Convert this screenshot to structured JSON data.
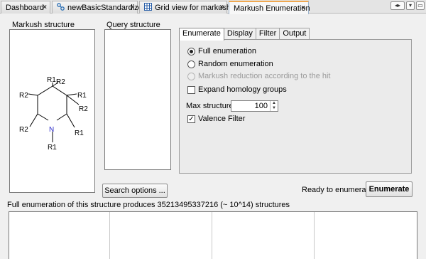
{
  "tabs": [
    {
      "label": "Dashboard",
      "icon": "close-icon"
    },
    {
      "label": "newBasicStandardizer",
      "icon": "standardizer-icon"
    },
    {
      "label": "Grid view for markush",
      "icon": "grid-icon"
    },
    {
      "label": "Markush Enumeration",
      "icon": "none"
    }
  ],
  "tab_close": "×",
  "window_buttons": [
    "◂▸",
    "▾",
    "▭"
  ],
  "markush": {
    "label": "Markush structure",
    "atoms": {
      "r1_top": "R1",
      "r2_top": "R2",
      "r2_left": "R2",
      "r1_right": "R1",
      "r2_right": "R2",
      "r2_bl": "R2",
      "n": "N",
      "r1_br": "R1",
      "r1_bottom": "R1"
    }
  },
  "query": {
    "label": "Query structure"
  },
  "options": {
    "tabs": [
      "Enumerate",
      "Display",
      "Filter",
      "Output"
    ],
    "full_enum": "Full enumeration",
    "random_enum": "Random enumeration",
    "markush_reduction": "Markush reduction according to the hit",
    "expand_homology": "Expand homology groups",
    "max_structures_label": "Max structures:",
    "max_structures_value": "100",
    "valence_filter": "Valence Filter",
    "check_mark": "✓"
  },
  "search_options_button": "Search options ...",
  "ready_status": "Ready to enumerate.",
  "enumerate_button": "Enumerate",
  "summary": "Full enumeration of this structure produces 35213495337216 (~ 10^14) structures"
}
